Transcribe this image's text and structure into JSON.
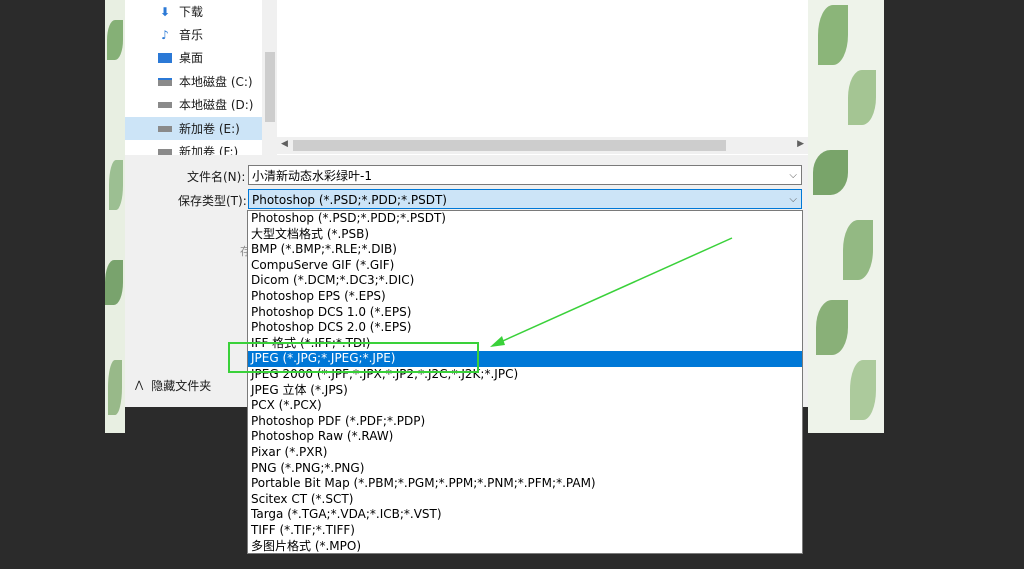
{
  "navigation": {
    "items": [
      {
        "label": "下载",
        "icon": "download-icon"
      },
      {
        "label": "音乐",
        "icon": "music-note-icon"
      },
      {
        "label": "桌面",
        "icon": "desktop-icon"
      },
      {
        "label": "本地磁盘 (C:)",
        "icon": "drive-icon"
      },
      {
        "label": "本地磁盘 (D:)",
        "icon": "drive-icon"
      },
      {
        "label": "新加卷 (E:)",
        "icon": "drive-icon"
      },
      {
        "label": "新加卷 (F:)",
        "icon": "drive-icon"
      }
    ],
    "selected_index": 5
  },
  "form": {
    "filename_label": "文件名(N):",
    "filename_value": "小清新动态水彩绿叶-1",
    "type_label": "保存类型(T):",
    "type_value": "Photoshop (*.PSD;*.PDD;*.PSDT)",
    "partial_text": "存"
  },
  "hide_folders_label": "隐藏文件夹",
  "file_types": [
    "Photoshop (*.PSD;*.PDD;*.PSDT)",
    "大型文档格式 (*.PSB)",
    "BMP (*.BMP;*.RLE;*.DIB)",
    "CompuServe GIF (*.GIF)",
    "Dicom (*.DCM;*.DC3;*.DIC)",
    "Photoshop EPS (*.EPS)",
    "Photoshop DCS 1.0 (*.EPS)",
    "Photoshop DCS 2.0 (*.EPS)",
    "IFF 格式 (*.IFF;*.TDI)",
    "JPEG (*.JPG;*.JPEG;*.JPE)",
    "JPEG 2000 (*.JPF;*.JPX;*.JP2;*.J2C;*.J2K;*.JPC)",
    "JPEG 立体 (*.JPS)",
    "PCX (*.PCX)",
    "Photoshop PDF (*.PDF;*.PDP)",
    "Photoshop Raw (*.RAW)",
    "Pixar (*.PXR)",
    "PNG (*.PNG;*.PNG)",
    "Portable Bit Map (*.PBM;*.PGM;*.PPM;*.PNM;*.PFM;*.PAM)",
    "Scitex CT (*.SCT)",
    "Targa (*.TGA;*.VDA;*.ICB;*.VST)",
    "TIFF (*.TIF;*.TIFF)",
    "多图片格式 (*.MPO)"
  ],
  "highlighted_type_index": 9,
  "colors": {
    "highlight": "#0078d7",
    "selection": "#cce4f7",
    "annotation": "#3ad13a"
  }
}
